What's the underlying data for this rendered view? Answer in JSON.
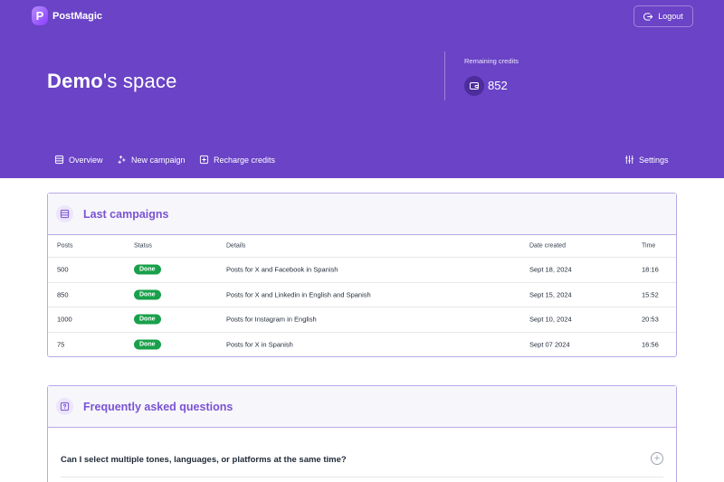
{
  "brand": {
    "logo_letter": "P",
    "name": "PostMagic"
  },
  "header": {
    "logout_label": "Logout",
    "space_name": "Demo",
    "space_suffix": "'s space",
    "credits_label": "Remaining credits",
    "credits_value": "852"
  },
  "nav": {
    "overview": "Overview",
    "new_campaign": "New campaign",
    "recharge": "Recharge credits",
    "settings": "Settings"
  },
  "campaigns": {
    "title": "Last campaigns",
    "columns": {
      "posts": "Posts",
      "status": "Status",
      "details": "Details",
      "date": "Date created",
      "time": "Time"
    },
    "rows": [
      {
        "posts": "500",
        "status": "Done",
        "details": "Posts for X and Facebook in Spanish",
        "date": "Sept 18, 2024",
        "time": "18:16"
      },
      {
        "posts": "850",
        "status": "Done",
        "details": "Posts for X and Linkedin in English and Spanish",
        "date": "Sept 15, 2024",
        "time": "15:52"
      },
      {
        "posts": "1000",
        "status": "Done",
        "details": "Posts for Instagram in English",
        "date": "Sept 10, 2024",
        "time": "20:53"
      },
      {
        "posts": "75",
        "status": "Done",
        "details": "Posts for X in Spanish",
        "date": "Sept 07 2024",
        "time": "16:56"
      }
    ]
  },
  "faq": {
    "title": "Frequently asked questions",
    "items": [
      {
        "question": "Can I select multiple tones, languages, or platforms at the same time?"
      }
    ]
  },
  "colors": {
    "header_bg": "#6a43c6",
    "accent": "#7a53d3",
    "status_done": "#18a04a"
  }
}
